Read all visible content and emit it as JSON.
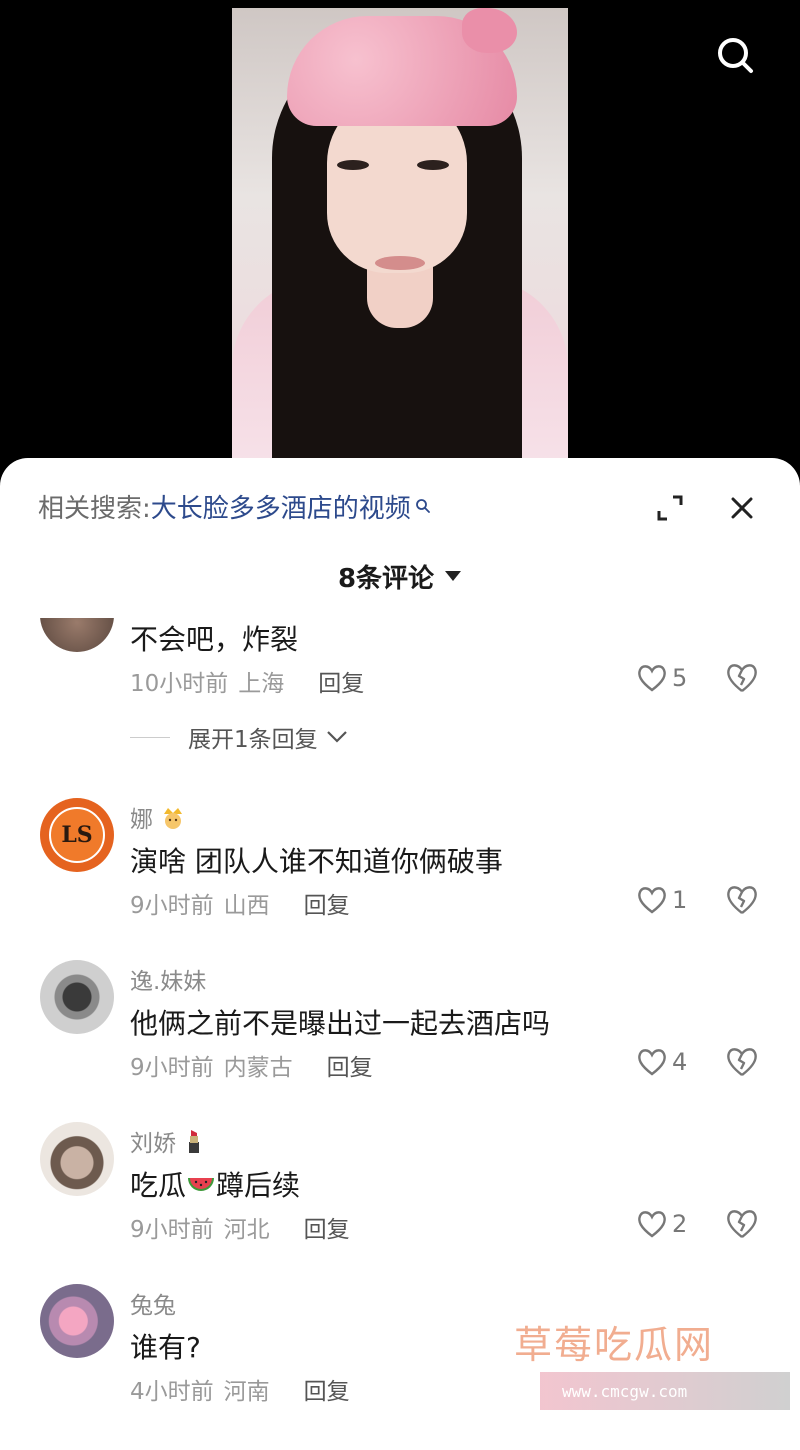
{
  "related_search": {
    "label": "相关搜索:",
    "keyword": "大长脸多多酒店的视频"
  },
  "comment_count": "8条评论",
  "comments": [
    {
      "text": "不会吧，炸裂",
      "time": "10小时前",
      "location": "上海",
      "reply_label": "回复",
      "likes": "5",
      "expand_replies": "展开1条回复"
    },
    {
      "username": "娜",
      "username_emoji": "crown-princess-emoji",
      "text": "演啥 团队人谁不知道你俩破事",
      "time": "9小时前",
      "location": "山西",
      "reply_label": "回复",
      "likes": "1",
      "avatar_text": "LS"
    },
    {
      "username": "逸.妹妹",
      "text": "他俩之前不是曝出过一起去酒店吗",
      "time": "9小时前",
      "location": "内蒙古",
      "reply_label": "回复",
      "likes": "4"
    },
    {
      "username": "刘娇",
      "username_emoji": "lipstick-emoji",
      "text_before": "吃瓜",
      "text_emoji": "watermelon-emoji",
      "text_after": "蹲后续",
      "time": "9小时前",
      "location": "河北",
      "reply_label": "回复",
      "likes": "2"
    },
    {
      "username": "兔兔",
      "text": "谁有?",
      "time": "4小时前",
      "location": "河南",
      "reply_label": "回复"
    }
  ],
  "watermark": {
    "title": "草莓吃瓜网",
    "url": "www.cmcgw.com"
  },
  "colors": {
    "sheet_bg": "#ffffff",
    "keyword": "#2d4a8c",
    "meta": "#9a9a9a",
    "watermark": "#f0a585"
  }
}
